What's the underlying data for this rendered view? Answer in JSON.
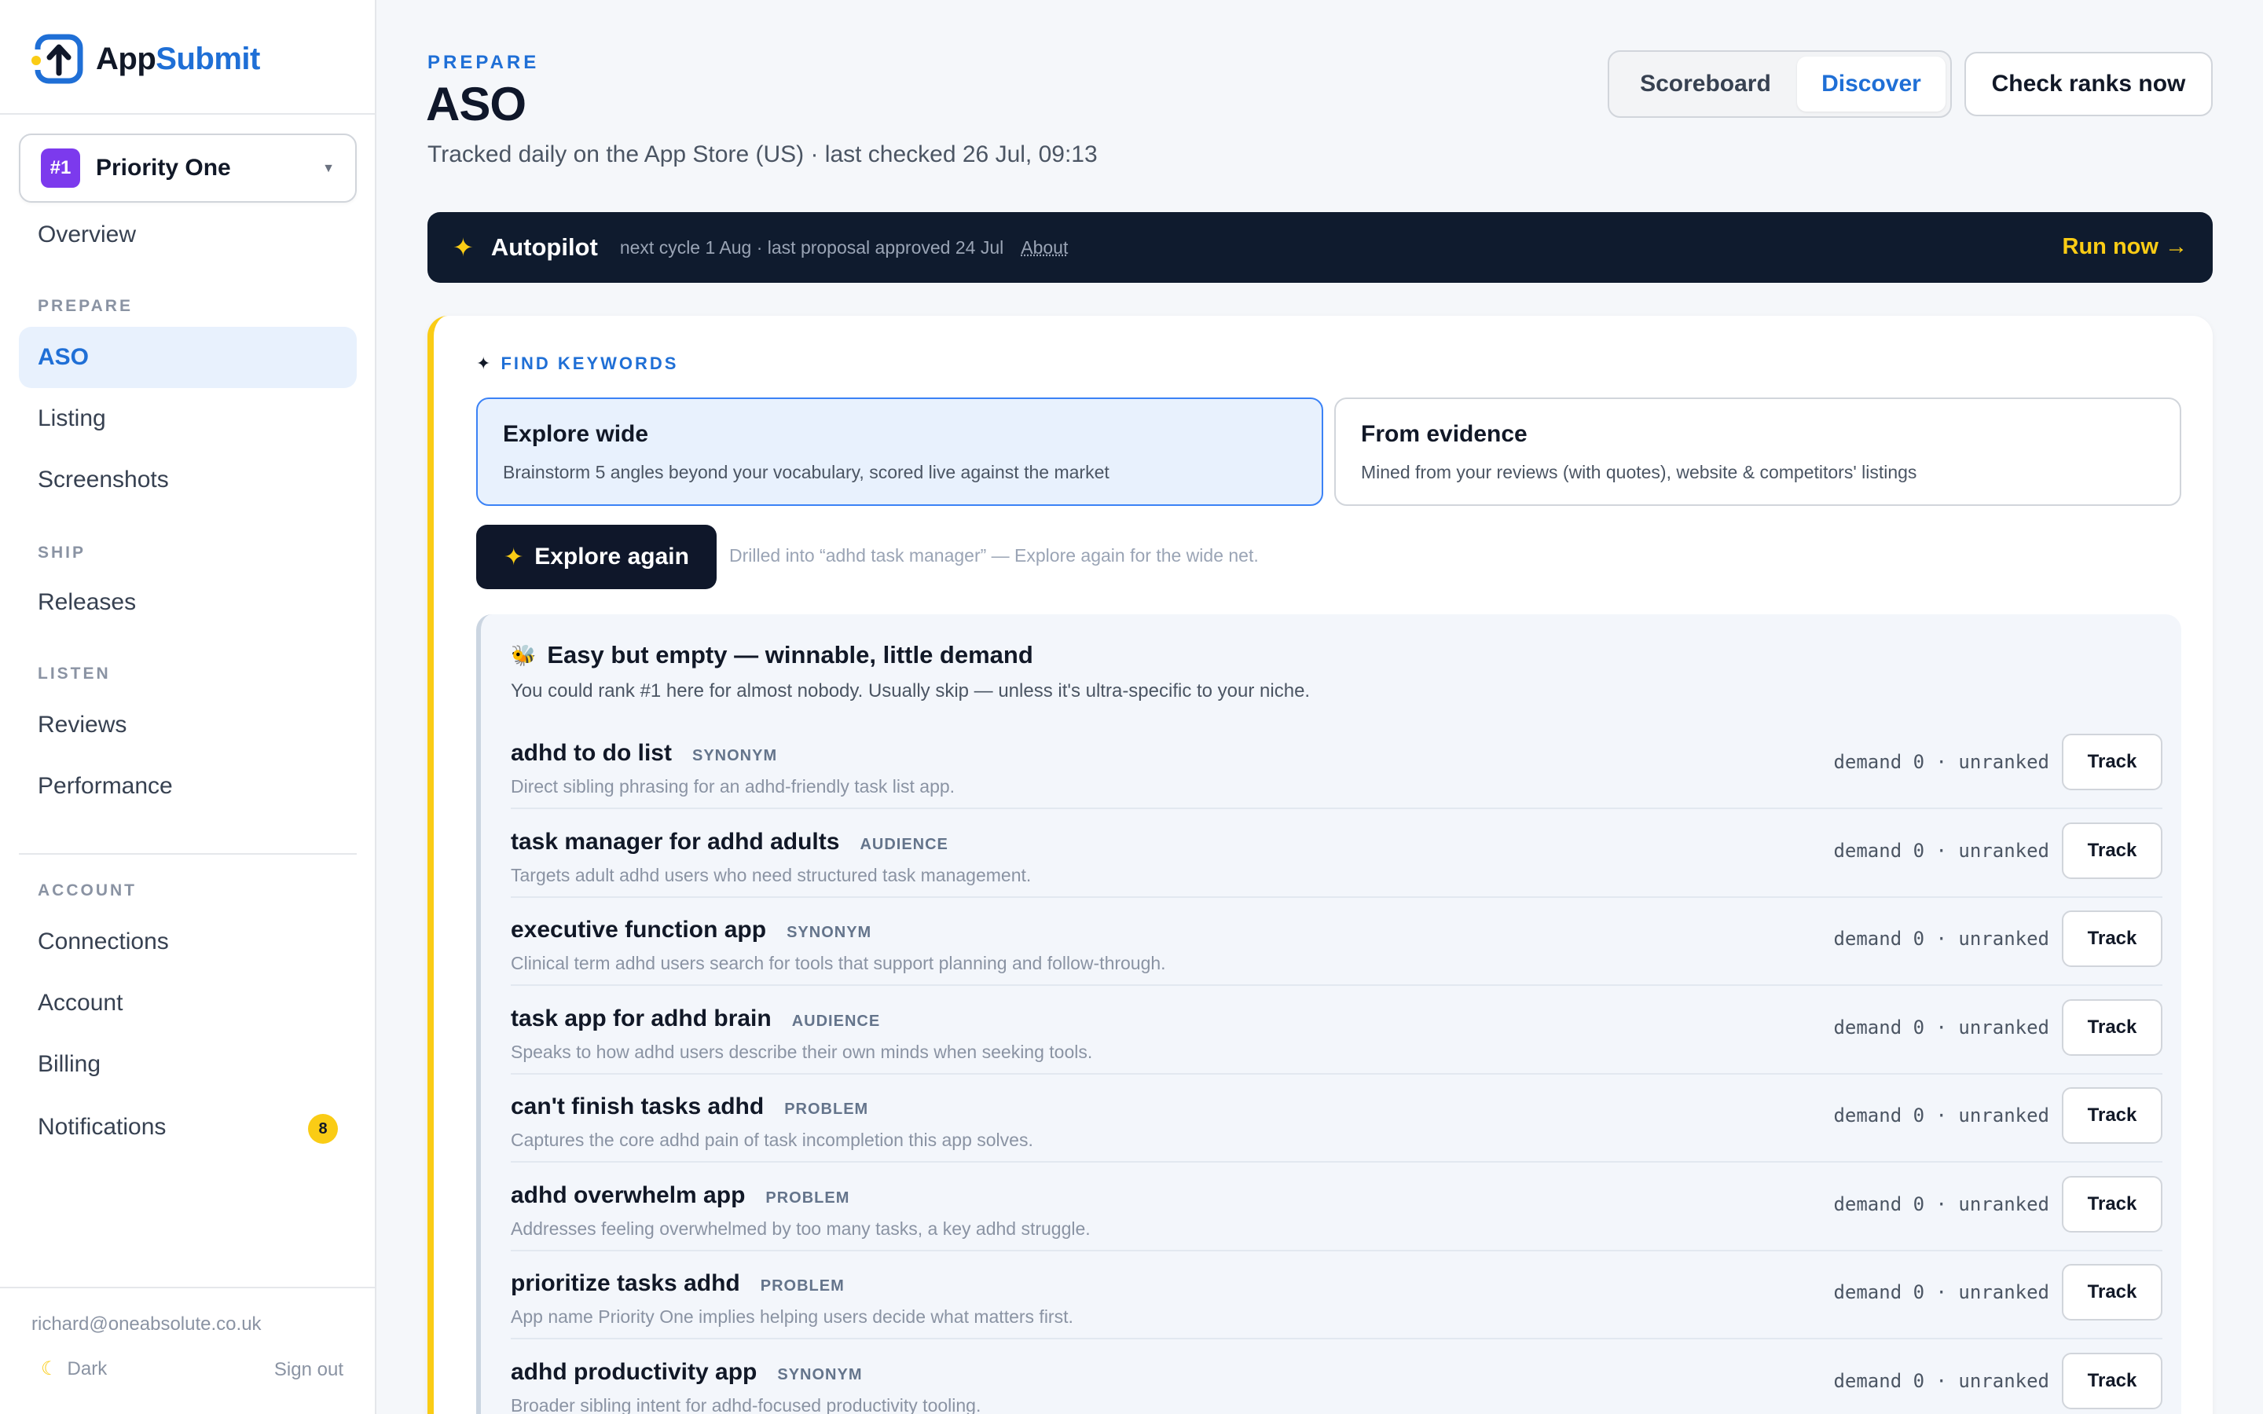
{
  "app": {
    "name_prefix": "App",
    "name_accent": "Submit"
  },
  "workspace": {
    "badge": "#1",
    "name": "Priority One"
  },
  "nav": {
    "overview": "Overview",
    "prepare_label": "PREPARE",
    "aso": "ASO",
    "listing": "Listing",
    "screenshots": "Screenshots",
    "ship_label": "SHIP",
    "releases": "Releases",
    "listen_label": "LISTEN",
    "reviews": "Reviews",
    "performance": "Performance",
    "account_label": "ACCOUNT",
    "connections": "Connections",
    "account": "Account",
    "billing": "Billing",
    "notifications": "Notifications",
    "notifications_count": "8"
  },
  "footer": {
    "email": "richard@oneabsolute.co.uk",
    "theme": "Dark",
    "signout": "Sign out"
  },
  "header": {
    "eyebrow": "PREPARE",
    "title": "ASO",
    "subtitle": "Tracked daily on the App Store (US) · last checked 26 Jul, 09:13",
    "tab_scoreboard": "Scoreboard",
    "tab_discover": "Discover",
    "check_ranks": "Check ranks now"
  },
  "autopilot": {
    "title": "Autopilot",
    "meta": "next cycle 1 Aug · last proposal approved 24 Jul",
    "about": "About",
    "run": "Run now →"
  },
  "find": {
    "label": "FIND KEYWORDS",
    "modes": [
      {
        "title": "Explore wide",
        "desc": "Brainstorm 5 angles beyond your vocabulary, scored live against the market"
      },
      {
        "title": "From evidence",
        "desc": "Mined from your reviews (with quotes), website & competitors' listings"
      }
    ],
    "explore_again": "Explore again",
    "drill_note": "Drilled into “adhd task manager” — Explore again for the wide net."
  },
  "group": {
    "title": "Easy but empty — winnable, little demand",
    "desc": "You could rank #1 here for almost nobody. Usually skip — unless it's ultra-specific to your niche.",
    "track_label": "Track",
    "keywords": [
      {
        "name": "adhd to do list",
        "tag": "SYNONYM",
        "desc": "Direct sibling phrasing for an adhd-friendly task list app.",
        "stats": "demand 0 · unranked"
      },
      {
        "name": "task manager for adhd adults",
        "tag": "AUDIENCE",
        "desc": "Targets adult adhd users who need structured task management.",
        "stats": "demand 0 · unranked"
      },
      {
        "name": "executive function app",
        "tag": "SYNONYM",
        "desc": "Clinical term adhd users search for tools that support planning and follow-through.",
        "stats": "demand 0 · unranked"
      },
      {
        "name": "task app for adhd brain",
        "tag": "AUDIENCE",
        "desc": "Speaks to how adhd users describe their own minds when seeking tools.",
        "stats": "demand 0 · unranked"
      },
      {
        "name": "can't finish tasks adhd",
        "tag": "PROBLEM",
        "desc": "Captures the core adhd pain of task incompletion this app solves.",
        "stats": "demand 0 · unranked"
      },
      {
        "name": "adhd overwhelm app",
        "tag": "PROBLEM",
        "desc": "Addresses feeling overwhelmed by too many tasks, a key adhd struggle.",
        "stats": "demand 0 · unranked"
      },
      {
        "name": "prioritize tasks adhd",
        "tag": "PROBLEM",
        "desc": "App name Priority One implies helping users decide what matters first.",
        "stats": "demand 0 · unranked"
      },
      {
        "name": "adhd productivity app",
        "tag": "SYNONYM",
        "desc": "Broader sibling intent for adhd-focused productivity tooling.",
        "stats": "demand 0 · unranked"
      }
    ]
  },
  "colors": {
    "accent": "#1f6fd6",
    "highlight": "#facc15",
    "dark": "#0f1b2e",
    "workspace_badge": "#7c3aed"
  },
  "icons": {
    "logo": "upload-arrow-icon",
    "caret": "caret-down-icon",
    "spark": "sparkle-icon",
    "theme": "moon-icon",
    "group": "bee-icon"
  }
}
